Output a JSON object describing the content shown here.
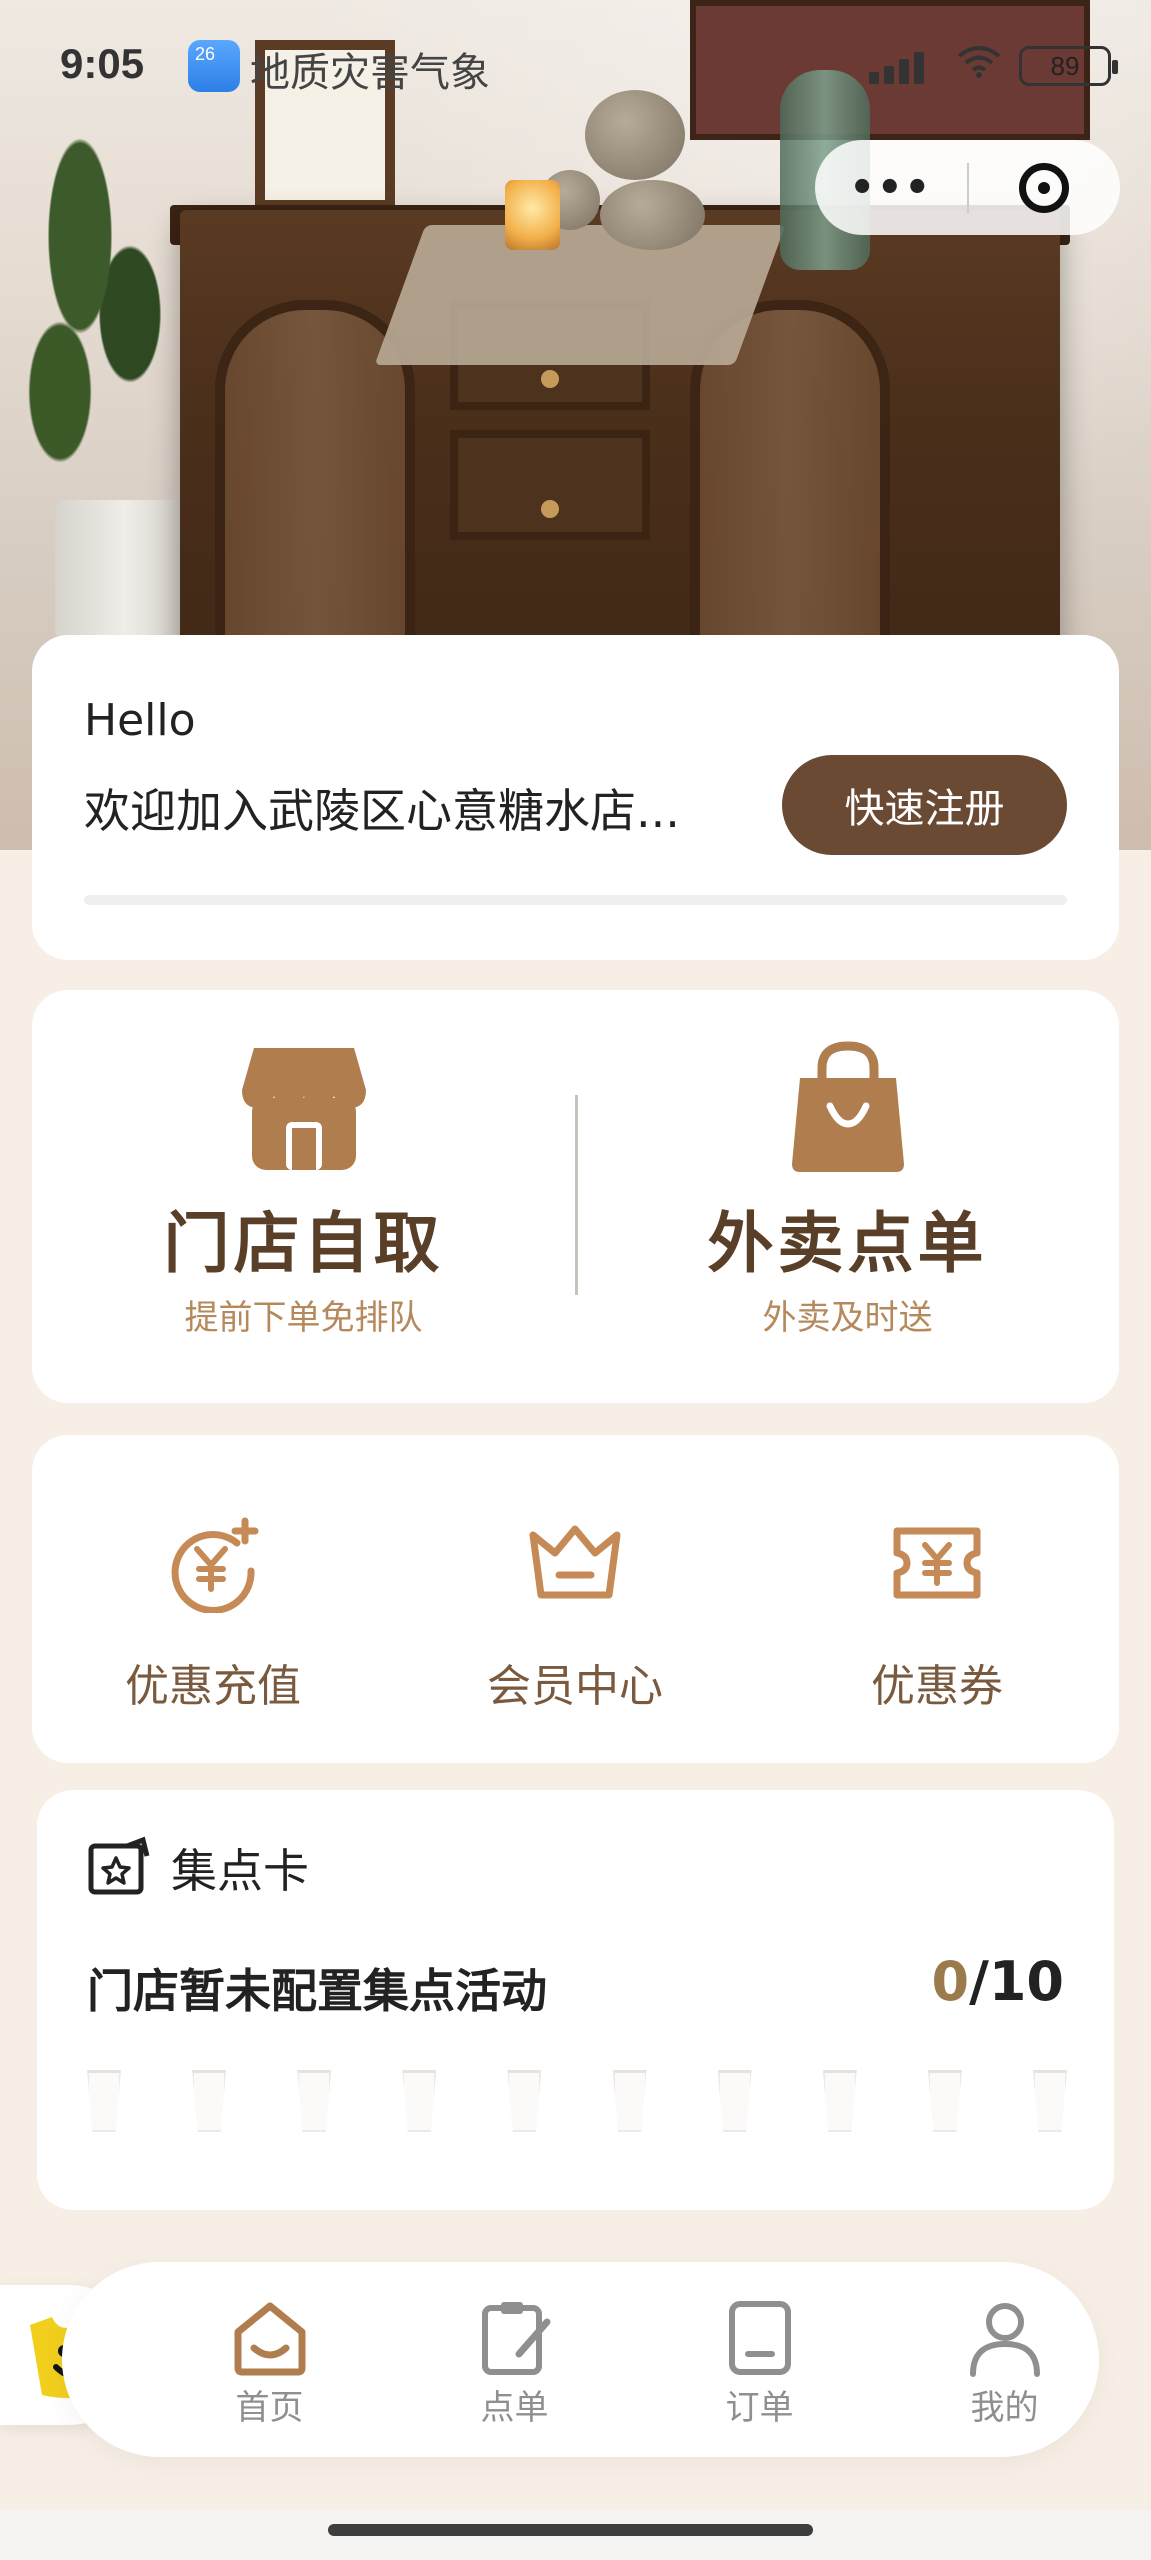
{
  "status_bar": {
    "time": "9:05",
    "weather_badge": "26",
    "weather_app": "地质灾害气象",
    "battery": "89"
  },
  "capsule": {
    "more_label": "•••"
  },
  "welcome": {
    "hello": "Hello",
    "message": "欢迎加入武陵区心意糖水店...",
    "register_button": "快速注册"
  },
  "order_options": [
    {
      "title": "门店自取",
      "subtitle": "提前下单免排队",
      "icon": "store-icon"
    },
    {
      "title": "外卖点单",
      "subtitle": "外卖及时送",
      "icon": "shopping-bag-icon"
    }
  ],
  "quick_links": [
    {
      "label": "优惠充值",
      "icon": "recharge-icon"
    },
    {
      "label": "会员中心",
      "icon": "crown-icon"
    },
    {
      "label": "优惠券",
      "icon": "coupon-icon"
    }
  ],
  "stamp_card": {
    "title": "集点卡",
    "message": "门店暂未配置集点活动",
    "current": "0",
    "total": "/10",
    "cup_count": 10
  },
  "tab_bar": [
    {
      "label": "首页",
      "icon": "home-icon",
      "active": true
    },
    {
      "label": "点单",
      "icon": "order-note-icon",
      "active": false
    },
    {
      "label": "订单",
      "icon": "orders-icon",
      "active": false
    },
    {
      "label": "我的",
      "icon": "profile-icon",
      "active": false
    }
  ],
  "colors": {
    "brand_brown": "#6b4a33",
    "title_brown": "#5a3f28",
    "icon_tan": "#b07d4f",
    "background": "#f7efe6"
  }
}
